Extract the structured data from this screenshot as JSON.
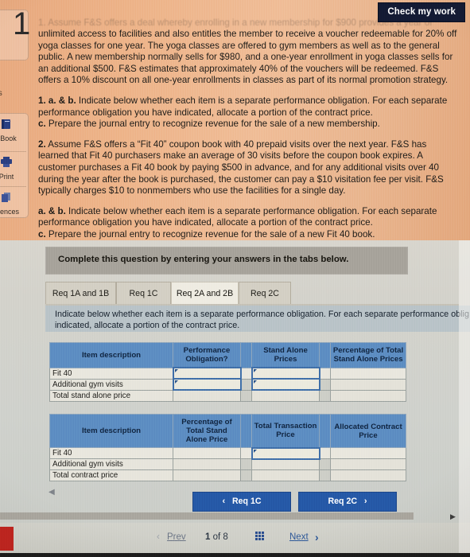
{
  "header": {
    "check_my_work_label": "Check my work"
  },
  "sidebar": {
    "question_number": "1",
    "points_label_partial": "ts",
    "tools": [
      {
        "name": "ebook",
        "icon": "book-icon",
        "label": "eBook",
        "glyph": "📘"
      },
      {
        "name": "print",
        "icon": "printer-icon",
        "label": "Print",
        "glyph": "🖨"
      },
      {
        "name": "references",
        "icon": "references-icon",
        "label": "erences",
        "glyph": "🗐"
      }
    ]
  },
  "problem": {
    "faded_top_line": "1. Assume F&S offers a deal whereby enrolling in a new membership for $900 provides a year of",
    "p1": "unlimited access to facilities and also entitles the member to receive a voucher redeemable for 20% off yoga classes for one year. The yoga classes are offered to gym members as well as to the general public. A new membership normally sells for $980, and a one-year enrollment in yoga classes sells for an additional $500. F&S estimates that approximately 40% of the vouchers will be redeemed. F&S offers a 10% discount on all one-year enrollments in classes as part of its normal promotion strategy.",
    "q1_ab_bold": "1. a. & b.",
    "q1_ab_text": " Indicate below whether each item is a separate performance obligation. For each separate performance obligation you have indicated, allocate a portion of the contract price.",
    "q1_c_bold": "c.",
    "q1_c_text": " Prepare the journal entry to recognize revenue for the sale of a new membership.",
    "q2_bold": "2.",
    "q2_text": " Assume F&S offers a “Fit 40” coupon book with 40 prepaid visits over the next year. F&S has learned that Fit 40 purchasers make an average of 30 visits before the coupon book expires. A customer purchases a Fit 40 book by paying $500 in advance, and for any additional visits over 40 during the year after the book is purchased, the customer can pay a $10 visitation fee per visit. F&S typically charges $10 to nonmembers who use the facilities for a single day.",
    "q2_ab_bold": "a. & b.",
    "q2_ab_text": " Indicate below whether each item is a separate performance obligation. For each separate performance obligation you have indicated, allocate a portion of the contract price.",
    "q2_c_bold": "c.",
    "q2_c_text": " Prepare the journal entry to recognize revenue for the sale of a new Fit 40 book."
  },
  "answer_panel": {
    "complete_bar_text": "Complete this question by entering your answers in the tabs below.",
    "tabs": [
      {
        "label": "Req 1A and 1B",
        "active": false
      },
      {
        "label": "Req 1C",
        "active": false
      },
      {
        "label": "Req 2A and 2B",
        "active": true
      },
      {
        "label": "Req 2C",
        "active": false
      }
    ],
    "instructions": "Indicate below whether each item is a separate performance obligation. For each separate performance oblig\nindicated, allocate a portion of the contract price.",
    "table1": {
      "headers": [
        "Item description",
        "Performance Obligation?",
        "Stand Alone Prices",
        "Percentage of Total Stand Alone Prices"
      ],
      "rows": [
        {
          "desc": "Fit 40",
          "c1": "",
          "c2": "",
          "c3": "",
          "input1": true,
          "input2": true
        },
        {
          "desc": "Additional gym visits",
          "c1": "",
          "c2": "",
          "c3": "",
          "input1": true,
          "input2": true
        },
        {
          "desc": "Total stand alone price",
          "c1": "",
          "c2": "",
          "c3": "",
          "input1": false,
          "input2": false
        }
      ]
    },
    "table2": {
      "headers": [
        "Item description",
        "Percentage of Total Stand Alone Price",
        "Total Transaction Price",
        "Allocated Contract Price"
      ],
      "rows": [
        {
          "desc": "Fit 40",
          "c1": "",
          "c2": "",
          "c3": "",
          "input1": false,
          "input2": true
        },
        {
          "desc": "Additional gym visits",
          "c1": "",
          "c2": "",
          "c3": "",
          "input1": false,
          "input2": false
        },
        {
          "desc": "Total contract price",
          "c1": "",
          "c2": "",
          "c3": "",
          "input1": false,
          "input2": false
        }
      ]
    },
    "nav": {
      "prev_label": "Req 1C",
      "next_label": "Req 2C",
      "prev_chevron": "‹",
      "next_chevron": "›"
    }
  },
  "bottom_bar": {
    "prev_label": "Prev",
    "prev_chevron": "‹",
    "page_current": "1",
    "page_of": "of",
    "page_total": "8",
    "grid_icon": "grid-icon",
    "next_label": "Next",
    "next_chevron": "›"
  },
  "colors": {
    "accent_blue": "#2558a6",
    "table_header_blue": "#5c8cc2",
    "check_work_navy": "#131a33",
    "instruction_bg": "#b9c3c8",
    "complete_bar_gray": "#a6a29a",
    "red_tab": "#c0241f"
  }
}
